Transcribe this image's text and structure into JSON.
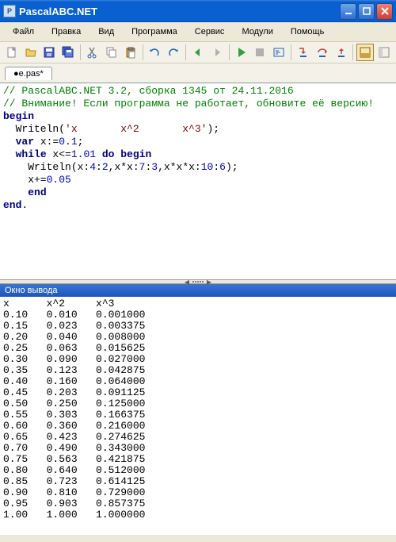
{
  "window": {
    "title": "PascalABC.NET"
  },
  "menu": {
    "file": "Файл",
    "edit": "Правка",
    "view": "Вид",
    "program": "Программа",
    "service": "Сервис",
    "modules": "Модули",
    "help": "Помощь"
  },
  "tab": {
    "name": "●e.pas*"
  },
  "code": {
    "c1": "// PascalABC.NET 3.2, сборка 1345 от 24.11.2016",
    "c2": "// Внимание! Если программа не работает, обновите её версию!",
    "begin": "begin",
    "l1a": "  Writeln(",
    "l1b": "'x       x^2       x^3'",
    "l1c": ");",
    "l2a": "  ",
    "l2var": "var",
    "l2b": " x:=",
    "l2n": "0.1",
    "l2c": ";",
    "l3a": "  ",
    "l3w": "while",
    "l3b": " x<=",
    "l3n": "1.01",
    "l3c": " ",
    "l3do": "do begin",
    "l4a": "    Writeln(x:",
    "l4n1": "4",
    "l4b": ":",
    "l4n2": "2",
    "l4c": ",x*x:",
    "l4n3": "7",
    "l4d": ":",
    "l4n4": "3",
    "l4e": ",x*x*x:",
    "l4n5": "10",
    "l4f": ":",
    "l4n6": "6",
    "l4g": ");",
    "l5a": "    x+=",
    "l5n": "0.05",
    "l6": "    ",
    "l6end": "end",
    "end": "end",
    "dot": "."
  },
  "output_panel": {
    "title": "Окно вывода"
  },
  "output_lines": [
    "x      x^2     x^3",
    "0.10   0.010   0.001000",
    "0.15   0.023   0.003375",
    "0.20   0.040   0.008000",
    "0.25   0.063   0.015625",
    "0.30   0.090   0.027000",
    "0.35   0.123   0.042875",
    "0.40   0.160   0.064000",
    "0.45   0.203   0.091125",
    "0.50   0.250   0.125000",
    "0.55   0.303   0.166375",
    "0.60   0.360   0.216000",
    "0.65   0.423   0.274625",
    "0.70   0.490   0.343000",
    "0.75   0.563   0.421875",
    "0.80   0.640   0.512000",
    "0.85   0.723   0.614125",
    "0.90   0.810   0.729000",
    "0.95   0.903   0.857375",
    "1.00   1.000   1.000000"
  ]
}
